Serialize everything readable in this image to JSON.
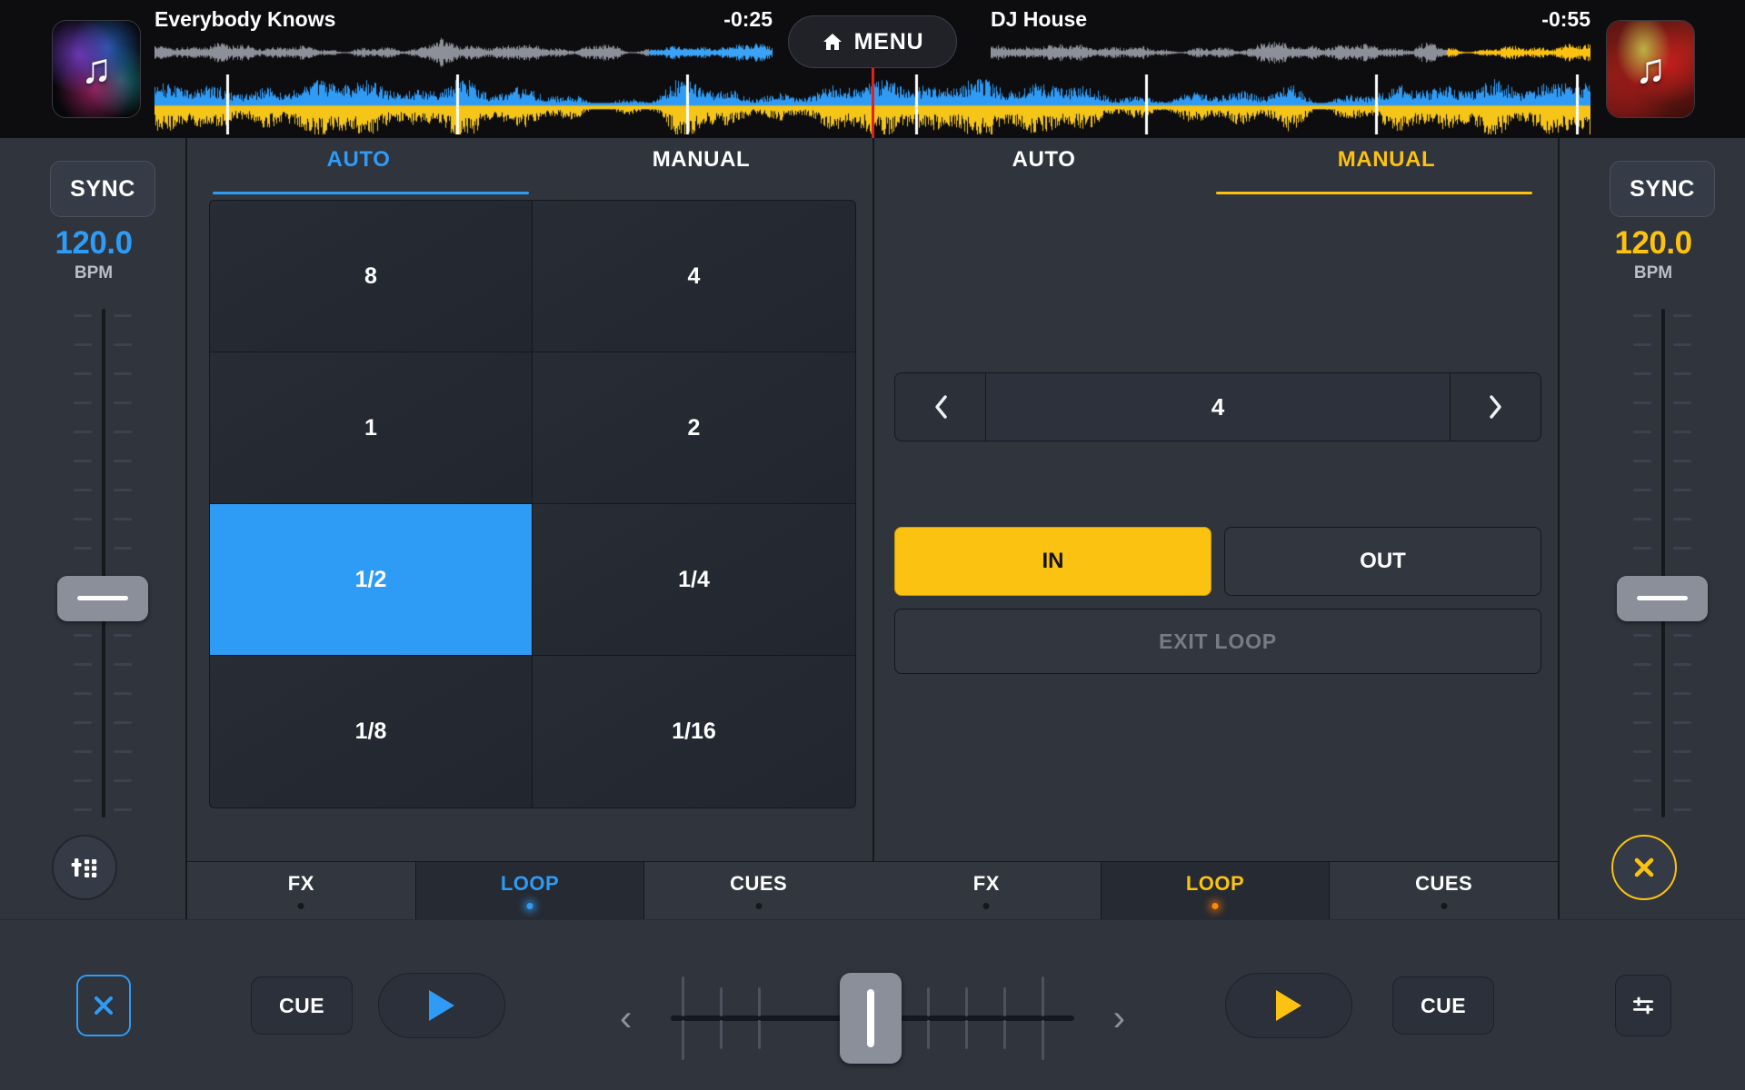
{
  "header": {
    "menu_button": {
      "label": "MENU",
      "icon": "home-icon"
    },
    "decks": [
      {
        "track_title": "Everybody Knows",
        "time_remaining": "-0:25",
        "artwork_icon": "music-note-icon",
        "accent": "#2f9bf5"
      },
      {
        "track_title": "DJ House",
        "time_remaining": "-0:55",
        "artwork_icon": "music-note-icon",
        "accent": "#fcc211"
      }
    ]
  },
  "left_rail": {
    "sync_label": "SYNC",
    "bpm_value": "120.0",
    "bpm_label": "BPM",
    "bpm_color": "#2f9bf5",
    "pitch_fader_position_pct": 56,
    "bottom_button_icon": "mixer-pads-icon"
  },
  "right_rail": {
    "sync_label": "SYNC",
    "bpm_value": "120.0",
    "bpm_label": "BPM",
    "bpm_color": "#fcc211",
    "pitch_fader_position_pct": 56,
    "bottom_button_icon": "close-circle-icon"
  },
  "left_deck": {
    "mode_tabs": [
      {
        "label": "AUTO",
        "active": true
      },
      {
        "label": "MANUAL",
        "active": false
      }
    ],
    "loop_grid": [
      {
        "label": "8",
        "selected": false
      },
      {
        "label": "4",
        "selected": false
      },
      {
        "label": "1",
        "selected": false
      },
      {
        "label": "2",
        "selected": false
      },
      {
        "label": "1/2",
        "selected": true
      },
      {
        "label": "1/4",
        "selected": false
      },
      {
        "label": "1/8",
        "selected": false
      },
      {
        "label": "1/16",
        "selected": false
      }
    ],
    "panel_tabs": [
      {
        "label": "FX",
        "active": false
      },
      {
        "label": "LOOP",
        "active": true
      },
      {
        "label": "CUES",
        "active": false
      }
    ]
  },
  "right_deck": {
    "mode_tabs": [
      {
        "label": "AUTO",
        "active": false
      },
      {
        "label": "MANUAL",
        "active": true
      }
    ],
    "beat_stepper": {
      "prev_icon": "chevron-left-icon",
      "next_icon": "chevron-right-icon",
      "value": "4"
    },
    "loop_in_label": "IN",
    "loop_out_label": "OUT",
    "loop_in_active": true,
    "loop_out_active": false,
    "exit_loop_label": "EXIT LOOP",
    "exit_loop_enabled": false,
    "panel_tabs": [
      {
        "label": "FX",
        "active": false
      },
      {
        "label": "LOOP",
        "active": true
      },
      {
        "label": "CUES",
        "active": false
      }
    ]
  },
  "transport": {
    "left_close_icon": "close-icon",
    "left_cue_label": "CUE",
    "left_play_icon": "play-icon",
    "crossfader": {
      "prev_icon": "chevron-left-icon",
      "next_icon": "chevron-right-icon",
      "position_pct": 50
    },
    "right_play_icon": "play-icon",
    "right_cue_label": "CUE",
    "right_mixer_icon": "sliders-icon"
  },
  "colors": {
    "deck_a_accent": "#2f9bf5",
    "deck_b_accent": "#fcc211",
    "playhead": "#e02020",
    "background": "#2f343d",
    "topbar_background": "#0d0d0f"
  }
}
